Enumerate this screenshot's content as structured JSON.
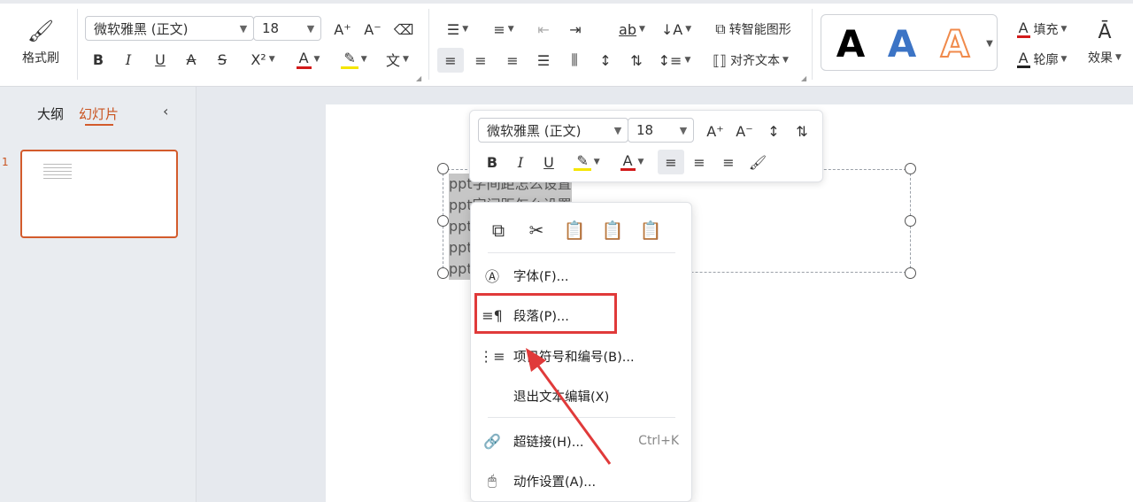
{
  "ribbon": {
    "format_painter_label": "格式刷",
    "font_name": "微软雅黑 (正文)",
    "font_size": "18",
    "bold": "B",
    "italic": "I",
    "underline": "U",
    "strikethrough": "A",
    "shadow": "S",
    "superscript": "X²",
    "smart_shape_label": "转智能图形",
    "align_text_label": "对齐文本",
    "fill_label": "填充",
    "outline_label": "轮廓",
    "effect_label": "效果",
    "wordart_letter": "A",
    "font_color_hex": "#d21a1a",
    "highlight_hex": "#f5e500"
  },
  "panel": {
    "tab_outline": "大纲",
    "tab_slides": "幻灯片",
    "slide_number": "1",
    "accent_hex": "#d35b2c"
  },
  "textbox": {
    "lines": [
      "ppt字间距怎么设置",
      "ppt字间距怎么设置",
      "ppt",
      "ppt",
      "ppt"
    ]
  },
  "mini_toolbar": {
    "font_name": "微软雅黑 (正文)",
    "font_size": "18"
  },
  "context_menu": {
    "font_item": "字体(F)...",
    "paragraph_item": "段落(P)...",
    "bullets_item": "项目符号和编号(B)...",
    "exit_item": "退出文本编辑(X)",
    "hyperlink_item": "超链接(H)...",
    "hyperlink_shortcut": "Ctrl+K",
    "action_item": "动作设置(A)...",
    "highlight_box_hex": "#e03a3a"
  }
}
